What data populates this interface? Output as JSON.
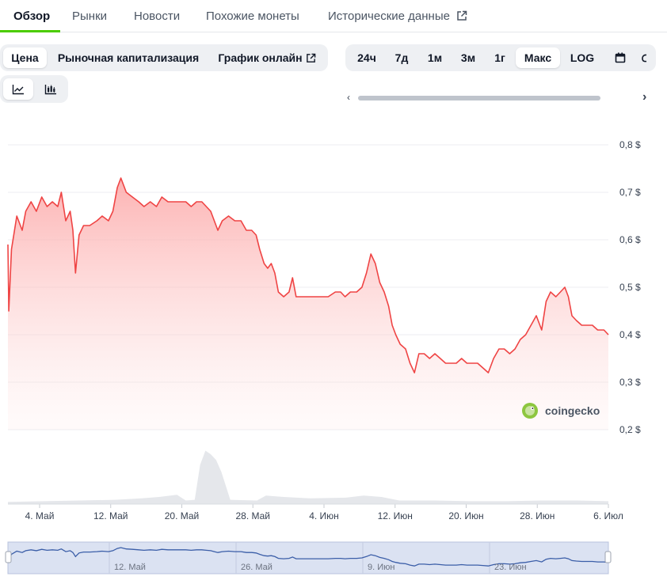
{
  "tabs": [
    {
      "label": "Обзор",
      "active": true
    },
    {
      "label": "Рынки"
    },
    {
      "label": "Новости"
    },
    {
      "label": "Похожие монеты"
    },
    {
      "label": "Исторические данные",
      "external": true
    }
  ],
  "chart_tabs": [
    {
      "label": "Цена",
      "active": true
    },
    {
      "label": "Рыночная капитализация"
    },
    {
      "label": "График онлайн",
      "external": true
    }
  ],
  "ranges": [
    {
      "label": "24ч"
    },
    {
      "label": "7д"
    },
    {
      "label": "1м"
    },
    {
      "label": "3м"
    },
    {
      "label": "1г"
    },
    {
      "label": "Макс",
      "active": true
    },
    {
      "label": "LOG"
    }
  ],
  "icons": [
    "line-chart-icon",
    "candlestick-icon",
    "calendar-icon",
    "external-link-icon",
    "chevron-left-icon",
    "chevron-right-icon",
    "coingecko-logo"
  ],
  "brand": "coingecko",
  "colors": {
    "line": "#ef4444",
    "fill_top": "#fca5a5",
    "accent": "#4bcc00",
    "navigator_fill": "#dbe2f2",
    "navigator_line": "#3b5ea8"
  },
  "chart_data": {
    "type": "area",
    "x_ticks": [
      "4. Май",
      "12. Май",
      "20. Май",
      "28. Май",
      "4. Июн",
      "12. Июн",
      "20. Июн",
      "28. Июн",
      "6. Июл"
    ],
    "y_ticks": [
      "0,2 $",
      "0,3 $",
      "0,4 $",
      "0,5 $",
      "0,6 $",
      "0,7 $",
      "0,8 $"
    ],
    "ylim": [
      0.2,
      0.8
    ],
    "xlim": [
      0,
      67.5
    ],
    "x_origin_label": "4. Май",
    "x_unit": "days",
    "series": [
      {
        "values": [
          [
            0,
            0.59
          ],
          [
            0.1,
            0.45
          ],
          [
            0.4,
            0.58
          ],
          [
            1,
            0.65
          ],
          [
            1.6,
            0.62
          ],
          [
            2,
            0.66
          ],
          [
            2.6,
            0.68
          ],
          [
            3.2,
            0.66
          ],
          [
            3.8,
            0.69
          ],
          [
            4.4,
            0.67
          ],
          [
            5,
            0.68
          ],
          [
            5.6,
            0.67
          ],
          [
            6,
            0.7
          ],
          [
            6.5,
            0.64
          ],
          [
            7,
            0.66
          ],
          [
            7.3,
            0.62
          ],
          [
            7.6,
            0.53
          ],
          [
            8,
            0.61
          ],
          [
            8.5,
            0.63
          ],
          [
            9.2,
            0.63
          ],
          [
            10,
            0.64
          ],
          [
            10.6,
            0.65
          ],
          [
            11.3,
            0.64
          ],
          [
            11.8,
            0.66
          ],
          [
            12.3,
            0.71
          ],
          [
            12.7,
            0.73
          ],
          [
            13.3,
            0.7
          ],
          [
            14,
            0.69
          ],
          [
            14.7,
            0.68
          ],
          [
            15.3,
            0.67
          ],
          [
            16,
            0.68
          ],
          [
            16.7,
            0.67
          ],
          [
            17.3,
            0.69
          ],
          [
            18,
            0.68
          ],
          [
            18.7,
            0.68
          ],
          [
            19.4,
            0.68
          ],
          [
            20,
            0.68
          ],
          [
            20.6,
            0.67
          ],
          [
            21.2,
            0.68
          ],
          [
            21.8,
            0.68
          ],
          [
            22.3,
            0.67
          ],
          [
            22.8,
            0.66
          ],
          [
            23.2,
            0.64
          ],
          [
            23.6,
            0.62
          ],
          [
            24.1,
            0.64
          ],
          [
            24.8,
            0.65
          ],
          [
            25.5,
            0.64
          ],
          [
            26.2,
            0.64
          ],
          [
            26.8,
            0.62
          ],
          [
            27.4,
            0.62
          ],
          [
            27.9,
            0.61
          ],
          [
            28.3,
            0.58
          ],
          [
            28.8,
            0.55
          ],
          [
            29.2,
            0.54
          ],
          [
            29.6,
            0.55
          ],
          [
            30.0,
            0.53
          ],
          [
            30.4,
            0.49
          ],
          [
            31,
            0.48
          ],
          [
            31.6,
            0.49
          ],
          [
            32,
            0.52
          ],
          [
            32.4,
            0.48
          ],
          [
            33,
            0.48
          ],
          [
            34,
            0.48
          ],
          [
            35,
            0.48
          ],
          [
            36,
            0.48
          ],
          [
            36.8,
            0.49
          ],
          [
            37.4,
            0.49
          ],
          [
            37.9,
            0.48
          ],
          [
            38.5,
            0.49
          ],
          [
            39.2,
            0.49
          ],
          [
            39.8,
            0.5
          ],
          [
            40.3,
            0.53
          ],
          [
            40.8,
            0.57
          ],
          [
            41.3,
            0.55
          ],
          [
            41.8,
            0.51
          ],
          [
            42.3,
            0.49
          ],
          [
            42.8,
            0.46
          ],
          [
            43.2,
            0.42
          ],
          [
            43.6,
            0.4
          ],
          [
            44.1,
            0.38
          ],
          [
            44.7,
            0.37
          ],
          [
            45.2,
            0.34
          ],
          [
            45.7,
            0.32
          ],
          [
            46.2,
            0.36
          ],
          [
            46.8,
            0.36
          ],
          [
            47.4,
            0.35
          ],
          [
            48,
            0.36
          ],
          [
            48.6,
            0.35
          ],
          [
            49.2,
            0.34
          ],
          [
            49.8,
            0.34
          ],
          [
            50.4,
            0.34
          ],
          [
            51,
            0.35
          ],
          [
            51.6,
            0.34
          ],
          [
            52.2,
            0.34
          ],
          [
            52.8,
            0.34
          ],
          [
            53.4,
            0.33
          ],
          [
            54,
            0.32
          ],
          [
            54.6,
            0.35
          ],
          [
            55.2,
            0.37
          ],
          [
            55.8,
            0.37
          ],
          [
            56.4,
            0.36
          ],
          [
            57,
            0.37
          ],
          [
            57.6,
            0.39
          ],
          [
            58.2,
            0.4
          ],
          [
            58.8,
            0.42
          ],
          [
            59.4,
            0.44
          ],
          [
            60,
            0.41
          ],
          [
            60.5,
            0.47
          ],
          [
            61,
            0.49
          ],
          [
            61.6,
            0.48
          ],
          [
            62.1,
            0.49
          ],
          [
            62.6,
            0.5
          ],
          [
            63.0,
            0.48
          ],
          [
            63.4,
            0.44
          ],
          [
            63.9,
            0.43
          ],
          [
            64.5,
            0.42
          ],
          [
            65.1,
            0.42
          ],
          [
            65.7,
            0.42
          ],
          [
            66.3,
            0.41
          ],
          [
            67,
            0.41
          ],
          [
            67.5,
            0.4
          ]
        ]
      }
    ],
    "volume": [
      [
        0,
        0.03
      ],
      [
        4,
        0.04
      ],
      [
        8,
        0.05
      ],
      [
        12,
        0.06
      ],
      [
        15,
        0.08
      ],
      [
        17,
        0.1
      ],
      [
        19,
        0.13
      ],
      [
        20,
        0.05
      ],
      [
        21,
        0.06
      ],
      [
        21.6,
        0.55
      ],
      [
        22.2,
        0.75
      ],
      [
        22.8,
        0.7
      ],
      [
        23.4,
        0.62
      ],
      [
        24,
        0.45
      ],
      [
        25,
        0.06
      ],
      [
        28,
        0.05
      ],
      [
        29,
        0.12
      ],
      [
        31,
        0.1
      ],
      [
        34,
        0.08
      ],
      [
        38,
        0.09
      ],
      [
        40,
        0.12
      ],
      [
        42,
        0.1
      ],
      [
        44,
        0.05
      ],
      [
        48,
        0.05
      ],
      [
        52,
        0.04
      ],
      [
        56,
        0.04
      ],
      [
        60,
        0.05
      ],
      [
        64,
        0.05
      ],
      [
        67.5,
        0.04
      ]
    ]
  },
  "navigator": {
    "ticks": [
      "12. Май",
      "26. Май",
      "9. Июн",
      "23. Июн"
    ]
  }
}
